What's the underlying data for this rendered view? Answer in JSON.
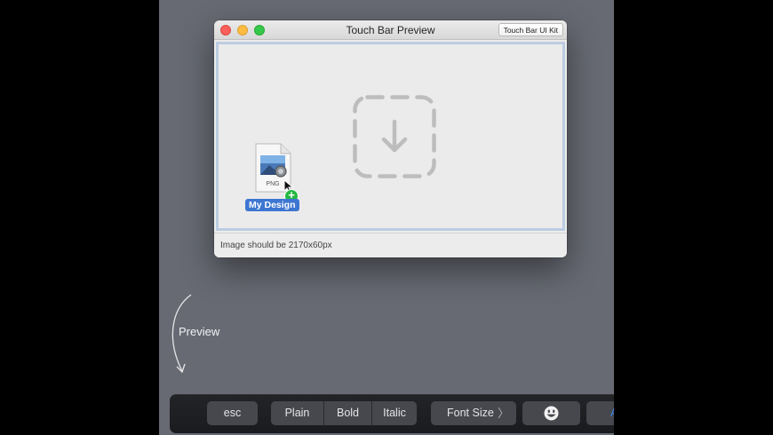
{
  "window": {
    "title": "Touch Bar Preview",
    "kit_button": "Touch Bar UI Kit",
    "status_text": "Image should be 2170x60px"
  },
  "dragged_file": {
    "type_label": "PNG",
    "name": "My Design",
    "badge": "+",
    "icon": "png-file-icon"
  },
  "dropzone": {
    "icon": "download-drop-icon"
  },
  "annotation": {
    "label": "Preview"
  },
  "touchbar": {
    "esc": "esc",
    "styles": [
      "Plain",
      "Bold",
      "Italic"
    ],
    "font_size": "Font Size",
    "font_size_chevron": "〉",
    "emoji_icon": "smiley-icon",
    "partial": "A"
  },
  "colors": {
    "stage_bg": "#676a73",
    "selection_blue": "#3d76d2",
    "drop_border": "#bccce2",
    "badge_green": "#26b842"
  }
}
